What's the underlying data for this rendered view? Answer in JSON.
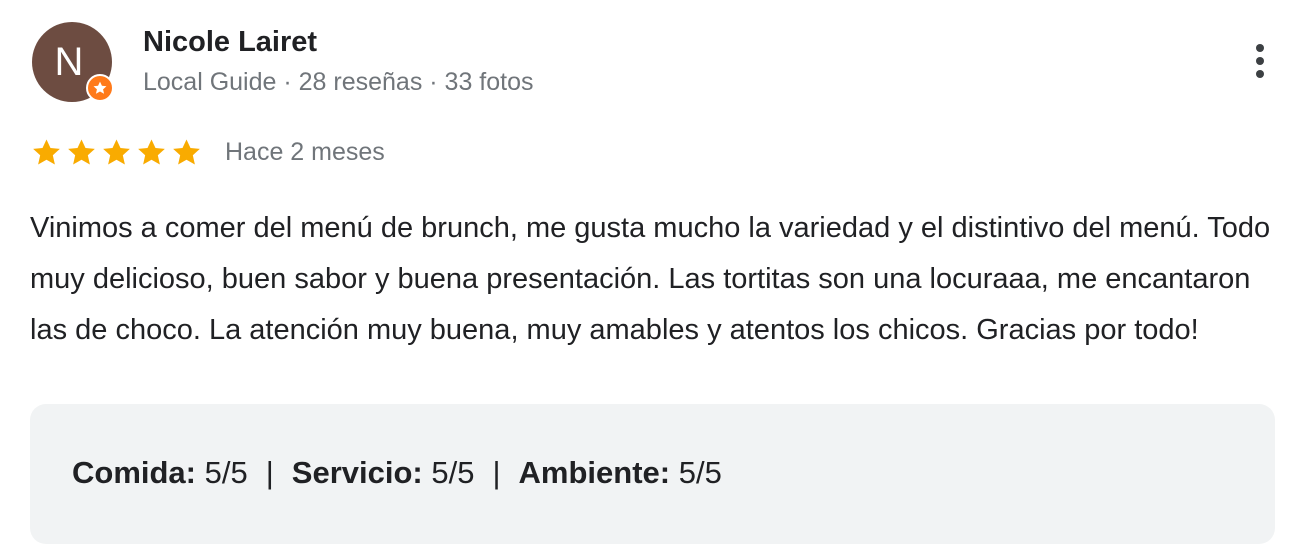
{
  "reviewer": {
    "initial": "N",
    "name": "Nicole Lairet",
    "meta": "Local Guide · 28 reseñas · 33 fotos",
    "avatar_color": "#6d4c41",
    "badge_color": "#ff7a1a",
    "badge_icon": "star-icon"
  },
  "rating": {
    "stars": 5,
    "max_stars": 5,
    "star_color": "#f9ab00",
    "time_ago": "Hace 2 meses"
  },
  "review": {
    "text": "Vinimos a comer del menú de brunch, me gusta mucho la variedad y el distintivo del menú. Todo muy delicioso, buen sabor y buena presentación. Las tortitas son una locuraaa, me encantaron las de choco. La atención muy buena, muy amables y atentos los chicos. Gracias por todo!"
  },
  "scores": {
    "separator": "|",
    "items": [
      {
        "label": "Comida:",
        "value": "5/5"
      },
      {
        "label": "Servicio:",
        "value": "5/5"
      },
      {
        "label": "Ambiente:",
        "value": "5/5"
      }
    ]
  },
  "actions": {
    "more_icon": "more-vert-icon"
  }
}
